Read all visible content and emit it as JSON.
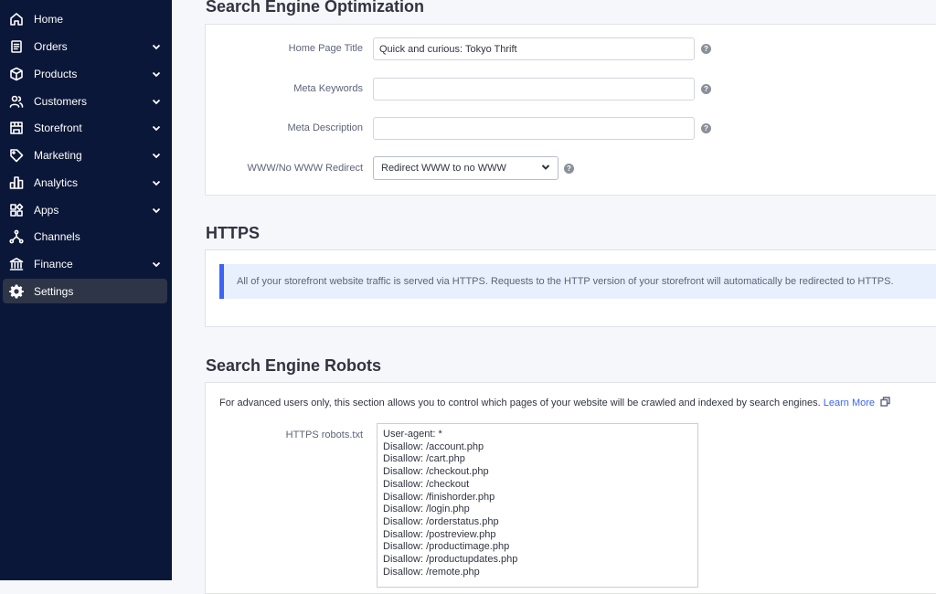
{
  "sidebar": {
    "items": [
      {
        "label": "Home",
        "icon": "home-icon",
        "expandable": false
      },
      {
        "label": "Orders",
        "icon": "orders-icon",
        "expandable": true
      },
      {
        "label": "Products",
        "icon": "products-icon",
        "expandable": true
      },
      {
        "label": "Customers",
        "icon": "customers-icon",
        "expandable": true
      },
      {
        "label": "Storefront",
        "icon": "storefront-icon",
        "expandable": true
      },
      {
        "label": "Marketing",
        "icon": "marketing-icon",
        "expandable": true
      },
      {
        "label": "Analytics",
        "icon": "analytics-icon",
        "expandable": true
      },
      {
        "label": "Apps",
        "icon": "apps-icon",
        "expandable": true
      },
      {
        "label": "Channels",
        "icon": "channels-icon",
        "expandable": false
      },
      {
        "label": "Finance",
        "icon": "finance-icon",
        "expandable": true
      },
      {
        "label": "Settings",
        "icon": "gear-icon",
        "expandable": false,
        "active": true
      }
    ]
  },
  "seo": {
    "title": "Search Engine Optimization",
    "home_page_title_label": "Home Page Title",
    "home_page_title_value": "Quick and curious: Tokyo Thrift",
    "meta_keywords_label": "Meta Keywords",
    "meta_keywords_value": "",
    "meta_description_label": "Meta Description",
    "meta_description_value": "",
    "www_redirect_label": "WWW/No WWW Redirect",
    "www_redirect_value": "Redirect WWW to no WWW",
    "help_glyph": "?"
  },
  "https": {
    "title": "HTTPS",
    "message": "All of your storefront website traffic is served via HTTPS. Requests to the HTTP version of your storefront will automatically be redirected to HTTPS."
  },
  "robots": {
    "title": "Search Engine Robots",
    "description": "For advanced users only, this section allows you to control which pages of your website will be crawled and indexed by search engines.",
    "learn_more": "Learn More",
    "https_robots_label": "HTTPS robots.txt",
    "https_robots_value": "User-agent: *\nDisallow: /account.php\nDisallow: /cart.php\nDisallow: /checkout.php\nDisallow: /checkout\nDisallow: /finishorder.php\nDisallow: /login.php\nDisallow: /orderstatus.php\nDisallow: /postreview.php\nDisallow: /productimage.php\nDisallow: /productupdates.php\nDisallow: /remote.php"
  },
  "colors": {
    "sidebar_bg": "#0b1738",
    "active_item_bg": "#2d3547",
    "accent": "#3c64f4",
    "info_bg": "#e8f0fd"
  }
}
